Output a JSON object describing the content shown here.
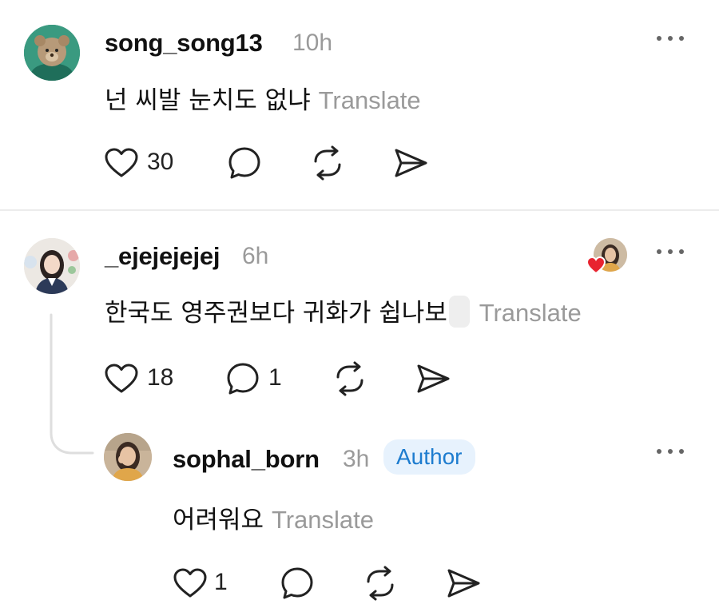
{
  "comments": [
    {
      "username": "song_song13",
      "time": "10h",
      "text": "넌 씨발 눈치도 없냐",
      "translate": "Translate",
      "likes": "30",
      "replies": "",
      "more": "..."
    },
    {
      "username": "_ejejejejej",
      "time": "6h",
      "text": "한국도 영주권보다 귀화가 쉽나보",
      "translate": "Translate",
      "likes": "18",
      "replies": "1",
      "more": "..."
    },
    {
      "username": "sophal_born",
      "time": "3h",
      "badge": "Author",
      "text": "어려워요",
      "translate": "Translate",
      "likes": "1",
      "replies": "",
      "more": "..."
    }
  ],
  "colors": {
    "secondary_text": "#9a9a9a",
    "author_badge_bg": "#e7f2fd",
    "author_badge_text": "#1d7ccf",
    "heart_red": "#e8232f"
  },
  "icons": [
    "heart-icon",
    "comment-icon",
    "repost-icon",
    "share-icon",
    "more-icon",
    "liked-by-author-icon"
  ]
}
